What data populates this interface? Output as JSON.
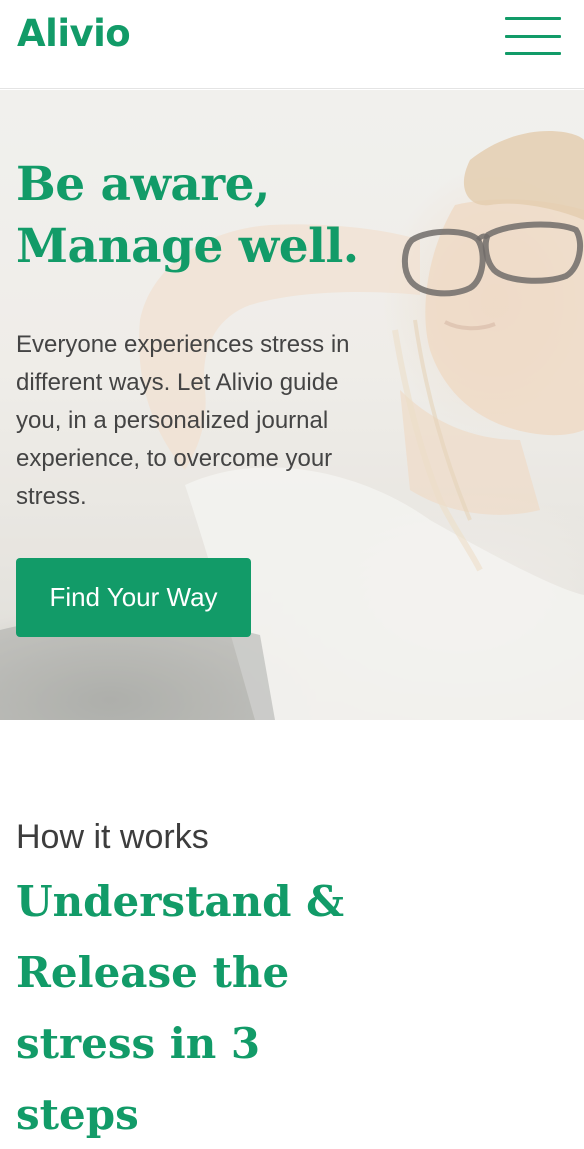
{
  "brand": {
    "logo_text": "Alivio",
    "accent_color": "#129b68"
  },
  "header": {
    "menu_icon": "hamburger-menu-icon"
  },
  "hero": {
    "title_lines": [
      "Be aware,",
      "Manage well."
    ],
    "body": "Everyone experiences stress in different ways. Let Alivio guide you, in a personalized journal experience, to overcome your stress.",
    "cta_label": "Find Your Way",
    "background_image": "smiling woman with glasses, hand behind head, in sunlight"
  },
  "how_it_works": {
    "eyebrow": "How it works",
    "title_lines": [
      "Understand &",
      "Release the",
      "stress in 3",
      "steps"
    ]
  }
}
